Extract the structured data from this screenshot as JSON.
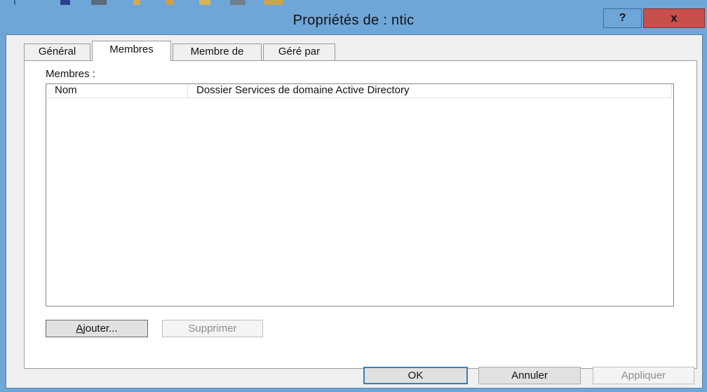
{
  "window": {
    "title": "Propriétés de : ntic",
    "help_label": "?",
    "close_label": "x"
  },
  "tabs": [
    {
      "label": "Général",
      "active": false
    },
    {
      "label": "Membres",
      "active": true
    },
    {
      "label": "Membre de",
      "active": false
    },
    {
      "label": "Géré par",
      "active": false
    }
  ],
  "members": {
    "section_label": "Membres :",
    "columns": [
      "Nom",
      "Dossier Services de domaine Active Directory"
    ],
    "rows": []
  },
  "panel_buttons": {
    "add_label_hotkey": "A",
    "add_label_rest": "jouter...",
    "remove_label": "Supprimer"
  },
  "dialog_buttons": {
    "ok": "OK",
    "cancel": "Annuler",
    "apply": "Appliquer"
  },
  "colors": {
    "frame": "#6fa6d8",
    "close": "#c7504b",
    "default_button_border": "#3c7fb1"
  }
}
